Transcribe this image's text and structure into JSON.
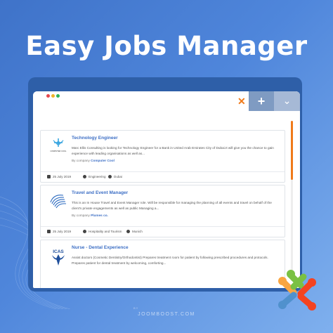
{
  "headline": "Easy Jobs Manager",
  "window": {
    "tab_close_icon": "close-icon",
    "tab_add_icon": "plus-icon",
    "tab_menu_icon": "chevron-down-icon",
    "accent": "#f07a1a"
  },
  "jobs": [
    {
      "title": "Technology Engineer",
      "description": "Marc Ellis Consulting is looking for Technology Engineer for a Bank in United Arab Emirates City of Dubai.It will give you the chance to gain experience with leading organisations as well as...",
      "company_prefix": "By company",
      "company": "Computer Cool",
      "date": "25 July 2019",
      "category": "Engineering",
      "location": "Dubai",
      "logo_text": "COMPUTER COOL"
    },
    {
      "title": "Travel and Event Manager",
      "description": "This is an In House Travel and Event Manager role. Will be responsible for managing the planning of all events and travel on behalf of the client's private engagements as well as public Managing a...",
      "company_prefix": "By company",
      "company": "Plumes co.",
      "date": "25 July 2019",
      "category": "Hospitality and Tourism",
      "location": "Munich",
      "logo_text": ""
    },
    {
      "title": "Nurse - Dental Experience",
      "description": "Assist doctors (Cosmetic Dentistry/Orthodontist) Prepares treatment room for patient by following prescribed procedures and protocols. Prepares patient for dental treatment by welcoming, comforting...",
      "logo_text": "ICAS"
    }
  ],
  "brand": {
    "by": "BY",
    "name": "JOOMBOOST.COM"
  }
}
